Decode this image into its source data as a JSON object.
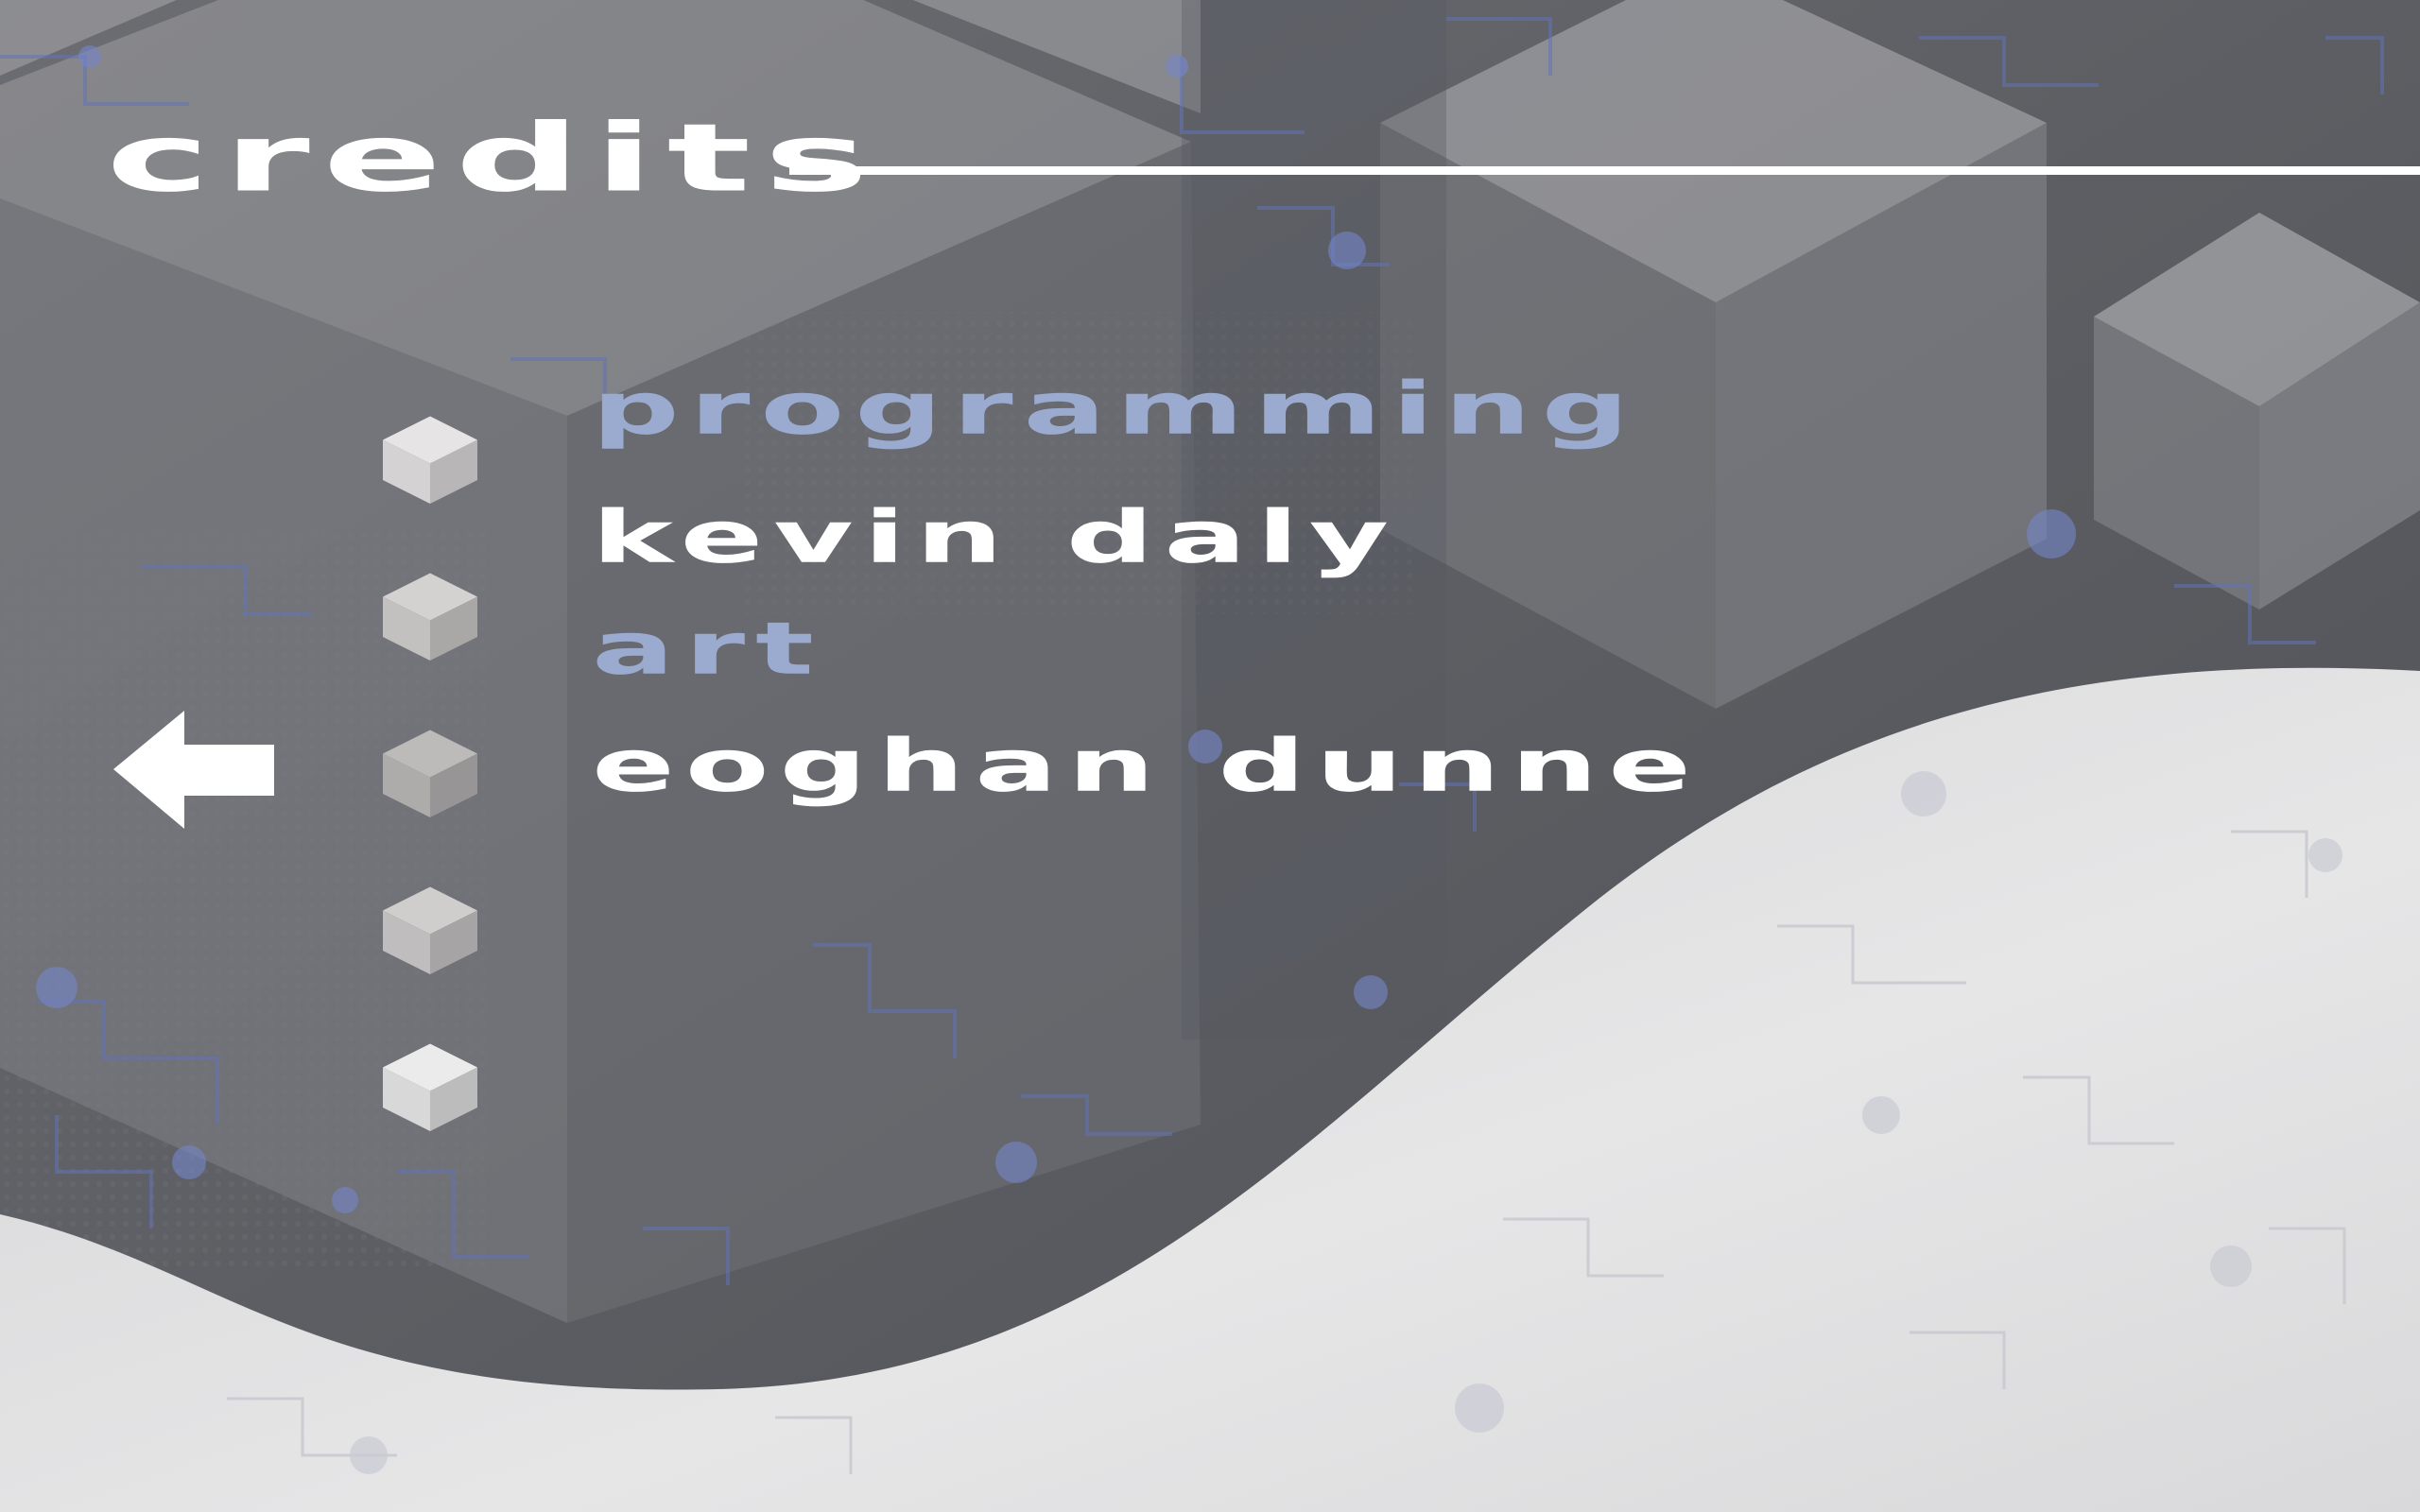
{
  "screen": {
    "title": "credits"
  },
  "credits": [
    {
      "heading": "programming",
      "name": "kevin daly"
    },
    {
      "heading": "art",
      "name": "eoghan dunne"
    }
  ],
  "navigation": {
    "back_icon": "left-arrow-icon"
  },
  "menu_cubes": {
    "icon": "cube-icon",
    "count": 5,
    "colors": [
      "#e6e4e4",
      "#d4d1d1",
      "#bdbaba",
      "#d0cdcd",
      "#ecebeb"
    ]
  },
  "colors": {
    "heading": "#9aabcf",
    "text": "#ffffff",
    "background": "#5a5a5a",
    "wave": "#e3e3e3",
    "circuit_accent": "#5b6fb8"
  }
}
